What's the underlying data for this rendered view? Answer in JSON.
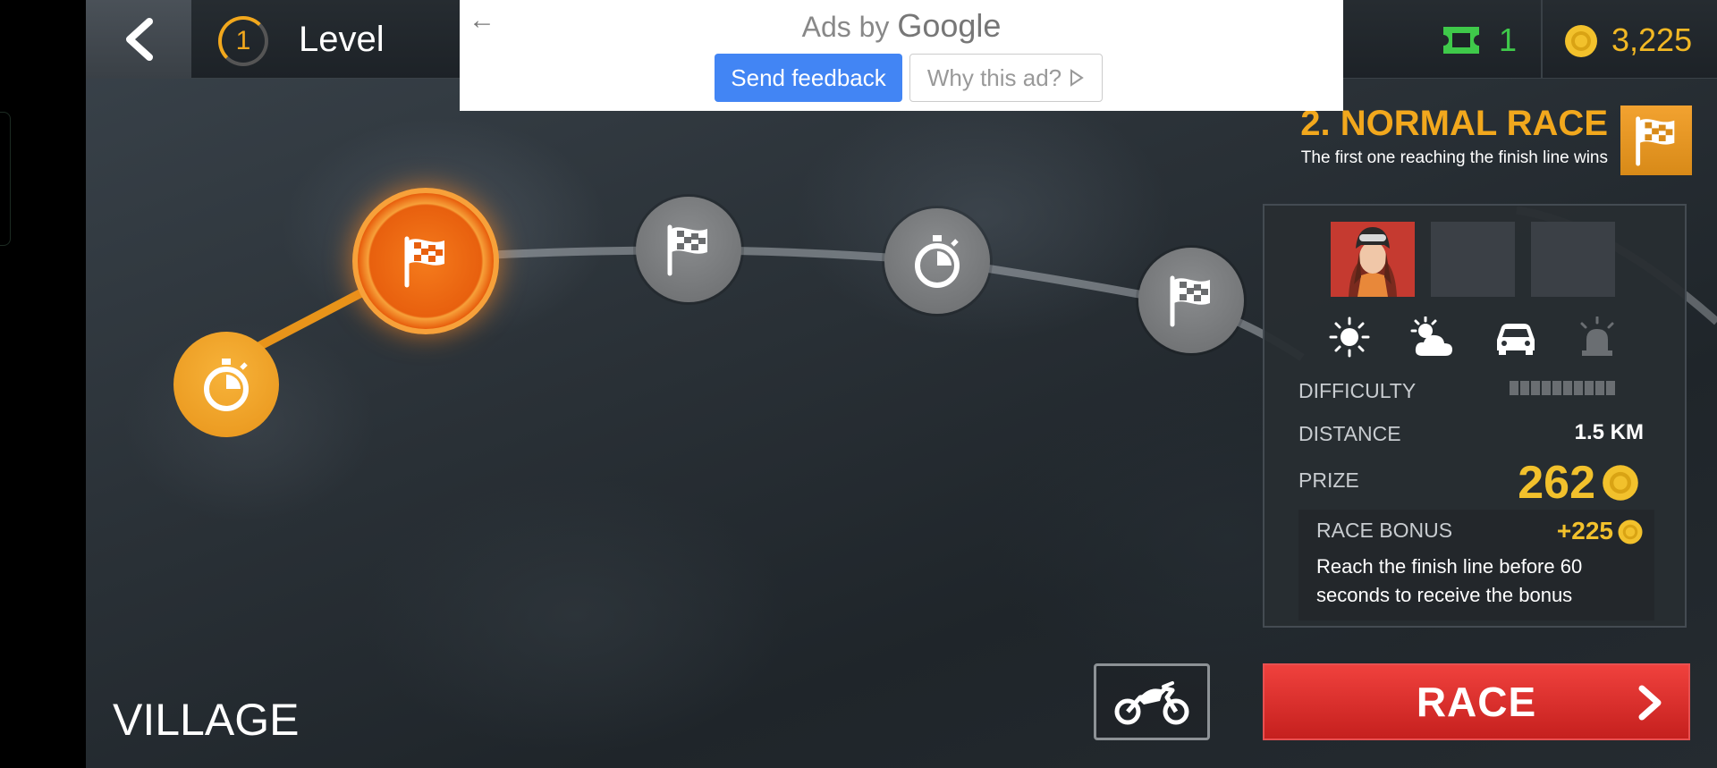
{
  "topbar": {
    "level_number": "1",
    "level_label": "Level",
    "tickets": "1",
    "coins": "3,225"
  },
  "ad": {
    "title_prefix": "Ads by",
    "title_brand": "Google",
    "send_feedback": "Send feedback",
    "why_this_ad": "Why this ad?"
  },
  "map": {
    "zone_name": "VILLAGE",
    "nodes": [
      {
        "type": "time-trial",
        "state": "completed"
      },
      {
        "type": "race",
        "state": "current"
      },
      {
        "type": "race",
        "state": "locked"
      },
      {
        "type": "time-trial",
        "state": "locked"
      },
      {
        "type": "race",
        "state": "locked"
      }
    ]
  },
  "race": {
    "title": "2. NORMAL RACE",
    "description": "The first one reaching the finish line wins",
    "conditions": [
      "sun-icon",
      "partly-cloudy-icon",
      "car-icon",
      "siren-icon"
    ],
    "difficulty_label": "DIFFICULTY",
    "difficulty_level": 0,
    "difficulty_max": 10,
    "distance_label": "DISTANCE",
    "distance_value": "1.5 KM",
    "prize_label": "PRIZE",
    "prize_value": "262",
    "bonus_label": "RACE BONUS",
    "bonus_value": "+225",
    "bonus_desc": "Reach the finish line before 60 seconds to receive the bonus",
    "race_button": "RACE"
  },
  "colors": {
    "accent_orange": "#f2a81d",
    "coin_gold": "#f2c12c",
    "ticket_green": "#3fc94a",
    "race_red": "#d8302c",
    "ad_blue": "#4285f4"
  }
}
